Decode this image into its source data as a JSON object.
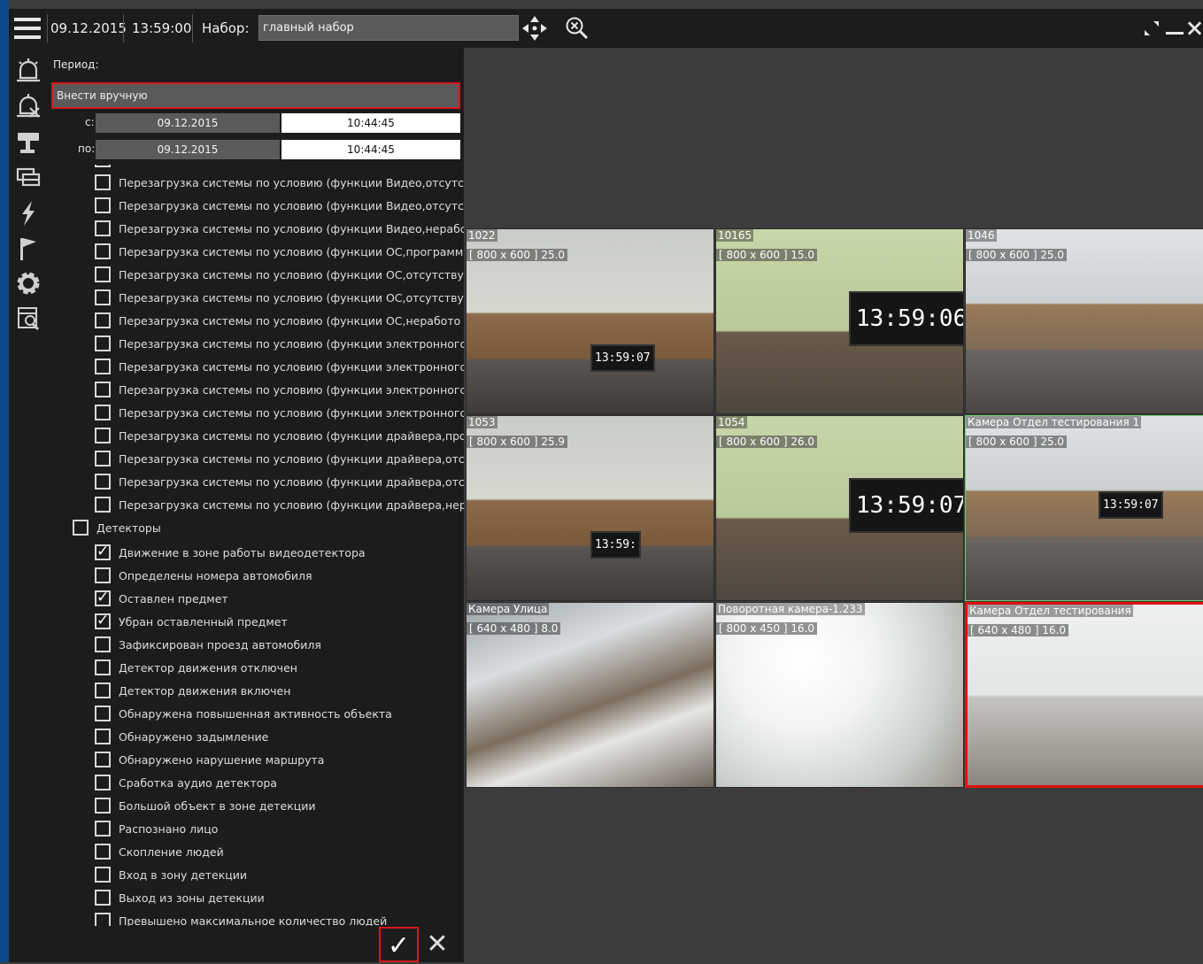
{
  "topbar": {
    "date": "09.12.2015",
    "time": "13:59:00",
    "set_label": "Набор:",
    "set_value": "главный набор",
    "icons": [
      "menu-icon",
      "move-arrows-icon",
      "zoom-reset-icon",
      "fullscreen-icon",
      "minimize-icon",
      "close-icon"
    ]
  },
  "sidebar_icons": [
    "alarm-icon",
    "alarm-off-icon",
    "camera-icon",
    "layouts-icon",
    "events-icon",
    "flag-icon",
    "gear-icon",
    "archive-search-icon"
  ],
  "filter": {
    "period_label": "Период:",
    "period_mode": "Внести вручную",
    "from_label": "с:",
    "to_label": "по:",
    "from_date": "09.12.2015",
    "from_time": "10:44:45",
    "to_date": "09.12.2015",
    "to_time": "10:44:45",
    "reboot_items": [
      "Перезагрузка системы по условию (функции Видео,отсутс",
      "Перезагрузка системы по условию (функции Видео,отсутс",
      "Перезагрузка системы по условию (функции Видео,нерабс",
      "Перезагрузка системы по условию (функции ОС,программ",
      "Перезагрузка системы по условию (функции ОС,отсутству",
      "Перезагрузка системы по условию (функции ОС,отсутству",
      "Перезагрузка системы по условию (функции ОС,неработо",
      "Перезагрузка системы по условию (функции электронногс",
      "Перезагрузка системы по условию (функции электронногс",
      "Перезагрузка системы по условию (функции электронногс",
      "Перезагрузка системы по условию (функции электронногс",
      "Перезагрузка системы по условию (функции драйвера,про",
      "Перезагрузка системы по условию (функции драйвера,отс",
      "Перезагрузка системы по условию (функции драйвера,отс",
      "Перезагрузка системы по условию (функции драйвера,нер"
    ],
    "detectors_group": "Детекторы",
    "detector_items": [
      {
        "label": "Движение в зоне работы видеодетектора",
        "checked": true
      },
      {
        "label": "Определены номера автомобиля",
        "checked": false
      },
      {
        "label": "Оставлен предмет",
        "checked": true
      },
      {
        "label": "Убран оставленный предмет",
        "checked": true
      },
      {
        "label": "Зафиксирован проезд автомобиля",
        "checked": false
      },
      {
        "label": "Детектор движения отключен",
        "checked": false
      },
      {
        "label": "Детектор движения включен",
        "checked": false
      },
      {
        "label": "Обнаружена повышенная активность объекта",
        "checked": false
      },
      {
        "label": "Обнаружено задымление",
        "checked": false
      },
      {
        "label": "Обнаружено нарушение маршрута",
        "checked": false
      },
      {
        "label": "Сработка аудио детектора",
        "checked": false
      },
      {
        "label": "Большой объект в зоне детекции",
        "checked": false
      },
      {
        "label": "Распознано лицо",
        "checked": false
      },
      {
        "label": "Скопление людей",
        "checked": false
      },
      {
        "label": "Вход в зону детекции",
        "checked": false
      },
      {
        "label": "Выход из зоны детекции",
        "checked": false
      },
      {
        "label": "Превышено максимальное количество людей",
        "checked": false
      }
    ],
    "ok_label": "✓",
    "cancel_label": "✕"
  },
  "cameras": [
    {
      "name": "1022",
      "res": "[ 800 x 600 ] 25.0",
      "clock": "13:59:07",
      "scene": "office",
      "selected": ""
    },
    {
      "name": "10165",
      "res": "[ 800 x 600 ] 15.0",
      "clock": "13:59:06",
      "scene": "office-monitor",
      "selected": ""
    },
    {
      "name": "1046",
      "res": "[ 800 x 600 ] 25.0",
      "clock": "",
      "scene": "office-wide",
      "selected": ""
    },
    {
      "name": "1053",
      "res": "[ 800 x 600 ] 25.9",
      "clock": "13:59:",
      "scene": "office",
      "selected": ""
    },
    {
      "name": "1054",
      "res": "[ 800 x 600 ] 26.0",
      "clock": "13:59:07",
      "scene": "office-monitor",
      "selected": ""
    },
    {
      "name": "Камера Отдел тестирования 1",
      "res": "[ 800 x 600 ] 25.0",
      "clock": "13:59:07",
      "scene": "office-wide",
      "selected": "green"
    },
    {
      "name": "Камера Улица",
      "res": "[ 640 x 480 ] 8.0",
      "clock": "",
      "scene": "street",
      "selected": ""
    },
    {
      "name": "Поворотная камера-1.233",
      "res": "[ 800 x 450 ] 16.0",
      "clock": "",
      "scene": "bright",
      "selected": ""
    },
    {
      "name": "Камера Отдел тестирования",
      "res": "[ 640 x 480 ] 16.0",
      "clock": "",
      "scene": "office-bright",
      "selected": "red"
    }
  ],
  "colors": {
    "accent_red": "#d51919",
    "panel": "#1c1c1c",
    "workspace": "#3c3c3c"
  }
}
